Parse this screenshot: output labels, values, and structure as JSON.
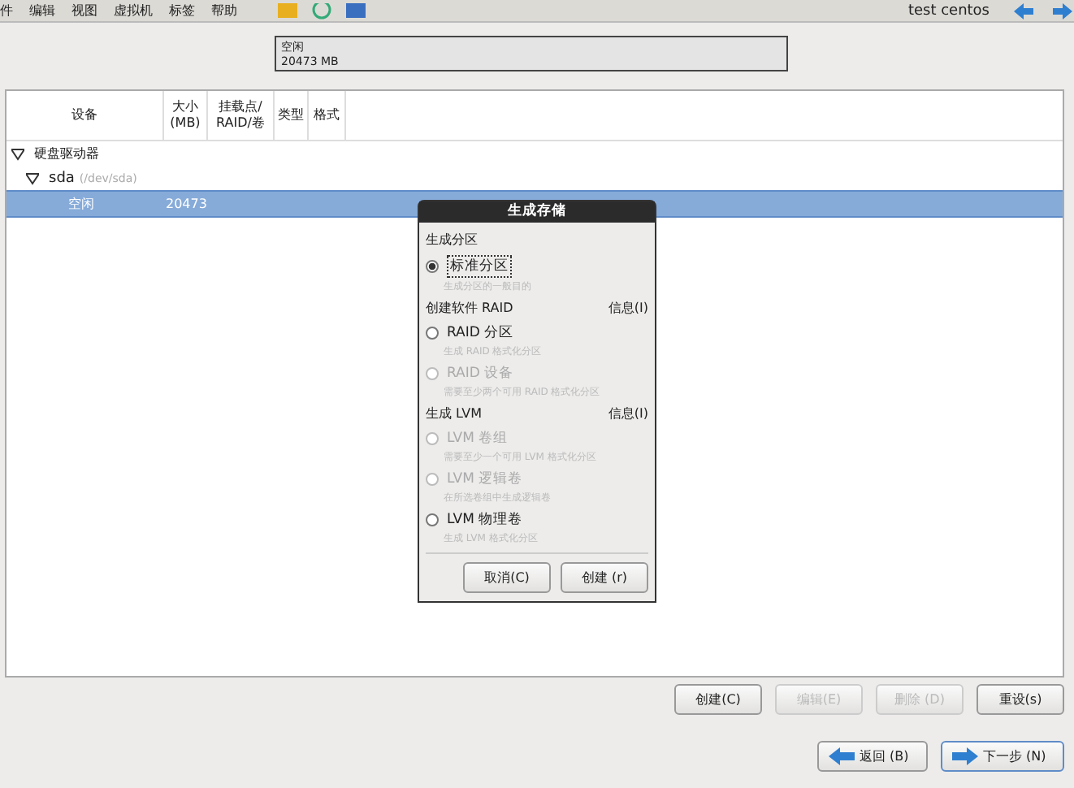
{
  "menu": [
    "件",
    "编辑",
    "视图",
    "虚拟机",
    "标签",
    "帮助"
  ],
  "user": "test centos",
  "disk_bar": {
    "label": "空闲",
    "size": "20473 MB"
  },
  "table": {
    "columns": [
      [
        "设备"
      ],
      [
        "大小",
        "(MB)"
      ],
      [
        "挂载点/",
        "RAID/卷"
      ],
      [
        "类型"
      ],
      [
        "格式"
      ]
    ],
    "tree": [
      {
        "label": "硬盘驱动器",
        "expanded": true,
        "children": [
          {
            "label": "sda",
            "detail": "(/dev/sda)",
            "expanded": true,
            "children": [
              {
                "label": "空闲",
                "size": "20473",
                "selected": true
              }
            ]
          }
        ]
      }
    ]
  },
  "dialog": {
    "title": "生成存储",
    "sections": [
      {
        "heading": "生成分区",
        "options": [
          {
            "label": "标准分区",
            "hint": "生成分区的一般目的",
            "selected": true,
            "disabled": false
          }
        ]
      },
      {
        "heading": "创建软件 RAID",
        "info": "信息(I)",
        "options": [
          {
            "label": "RAID 分区",
            "hint": "生成 RAID 格式化分区",
            "selected": false,
            "disabled": false
          },
          {
            "label": "RAID 设备",
            "hint": "需要至少两个可用 RAID 格式化分区",
            "selected": false,
            "disabled": true
          }
        ]
      },
      {
        "heading": "生成 LVM",
        "info": "信息(I)",
        "options": [
          {
            "label": "LVM 卷组",
            "hint": "需要至少一个可用 LVM 格式化分区",
            "selected": false,
            "disabled": true
          },
          {
            "label": "LVM 逻辑卷",
            "hint": "在所选卷组中生成逻辑卷",
            "selected": false,
            "disabled": true
          },
          {
            "label": "LVM 物理卷",
            "hint": "生成 LVM 格式化分区",
            "selected": false,
            "disabled": false
          }
        ]
      }
    ],
    "buttons": [
      {
        "label": "取消(C)"
      },
      {
        "label": "创建 (r)"
      }
    ]
  },
  "actions": [
    {
      "label": "创建(C)",
      "disabled": false
    },
    {
      "label": "编辑(E)",
      "disabled": true
    },
    {
      "label": "删除 (D)",
      "disabled": true
    },
    {
      "label": "重设(s)",
      "disabled": false
    }
  ],
  "nav": [
    {
      "label": "返回 (B)",
      "kind": "back"
    },
    {
      "label": "下一步 (N)",
      "kind": "next"
    }
  ]
}
